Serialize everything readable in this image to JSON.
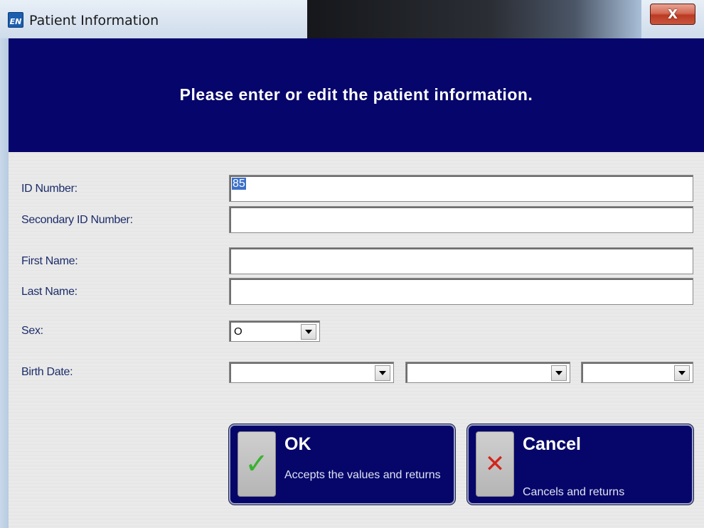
{
  "window": {
    "title": "Patient Information",
    "app_icon": "en-logo-icon",
    "close_label": "X"
  },
  "header": {
    "message": "Please enter or edit the patient information."
  },
  "form": {
    "id_number": {
      "label": "ID Number:",
      "value": "85"
    },
    "secondary_id": {
      "label": "Secondary ID Number:",
      "value": ""
    },
    "first_name": {
      "label": "First Name:",
      "value": ""
    },
    "last_name": {
      "label": "Last Name:",
      "value": ""
    },
    "sex": {
      "label": "Sex:",
      "value": "O"
    },
    "birth_date": {
      "label": "Birth Date:",
      "day": "",
      "month": "",
      "year": ""
    }
  },
  "buttons": {
    "ok": {
      "title": "OK",
      "description": "Accepts the values and returns",
      "icon": "checkmark-icon"
    },
    "cancel": {
      "title": "Cancel",
      "description": "Cancels and returns",
      "icon": "cross-icon"
    }
  },
  "colors": {
    "header_band": "#05056b",
    "button_bg": "#06066a",
    "label_text": "#1c2c6a",
    "check": "#39b22e",
    "cross": "#d3251a"
  }
}
